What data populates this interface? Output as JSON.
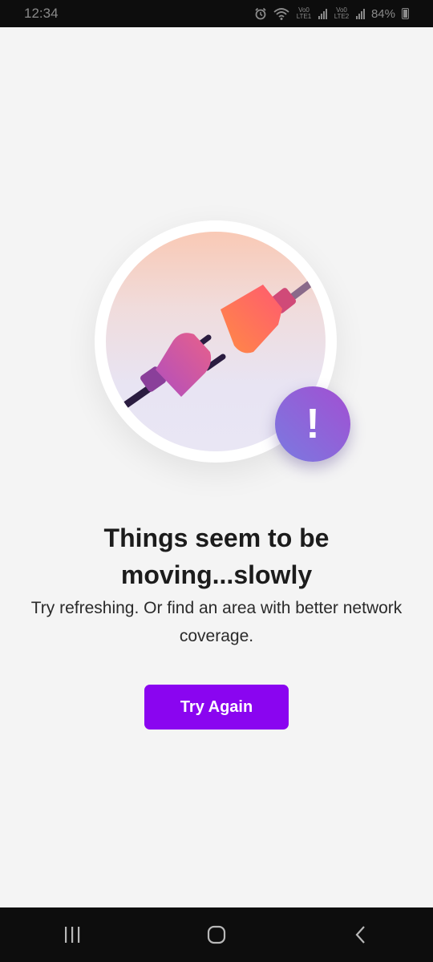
{
  "status_bar": {
    "time": "12:34",
    "sim1_label": "Vo0 LTE1",
    "sim2_label": "Vo0 LTE2",
    "battery": "84%",
    "icons": [
      "alarm-icon",
      "wifi-icon",
      "signal-icon",
      "battery-icon"
    ]
  },
  "illustration": {
    "badge": "!",
    "colors": {
      "plug_left": "#c55bb2",
      "plug_right": "#ff6f5c",
      "badge": "#9a58d6"
    }
  },
  "content": {
    "title": "Things seem to be moving...slowly",
    "subtitle": "Try refreshing. Or find an area with better network coverage."
  },
  "actions": {
    "try_again_label": "Try Again",
    "accent_color": "#8a05f0"
  },
  "nav": {
    "icons": [
      "recent-apps-icon",
      "home-icon",
      "back-icon"
    ]
  }
}
